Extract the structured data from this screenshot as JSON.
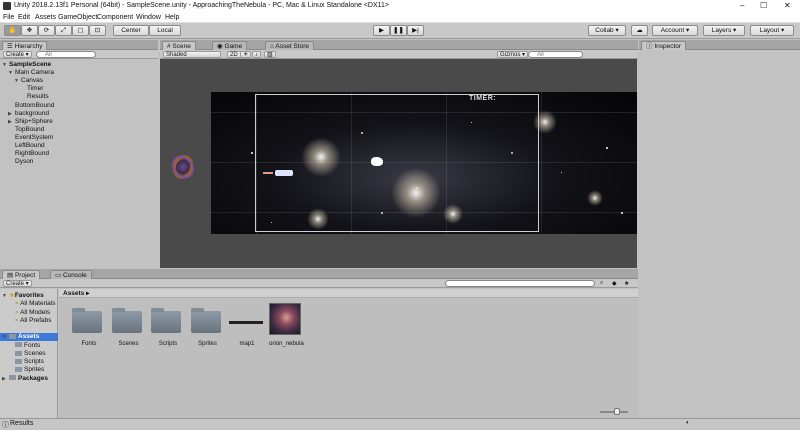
{
  "window": {
    "title": "Unity 2018.2.13f1 Personal (64bit) - SampleScene.unity - ApproachingTheNebula - PC, Mac & Linux Standalone <DX11>",
    "minimize": "–",
    "maximize": "☐",
    "close": "✕"
  },
  "menu": [
    "File",
    "Edit",
    "Assets",
    "GameObject",
    "Component",
    "Window",
    "Help"
  ],
  "toolbar": {
    "pivot": "Center",
    "space": "Local",
    "collab": "Collab ▾",
    "account": "Account ▾",
    "layers": "Layers ▾",
    "layout": "Layout ▾"
  },
  "hierarchy": {
    "tab": "Hierarchy",
    "create": "Create ▾",
    "search_placeholder": "All",
    "items": [
      {
        "label": "SampleScene",
        "indent": 0,
        "arrow": "▼",
        "bold": true
      },
      {
        "label": "Main Camera",
        "indent": 1,
        "arrow": "▼"
      },
      {
        "label": "Canvas",
        "indent": 2,
        "arrow": "▼"
      },
      {
        "label": "Timer",
        "indent": 3,
        "arrow": ""
      },
      {
        "label": "Results",
        "indent": 3,
        "arrow": ""
      },
      {
        "label": "BottomBound",
        "indent": 1,
        "arrow": ""
      },
      {
        "label": "background",
        "indent": 1,
        "arrow": "▶"
      },
      {
        "label": "Ship+Sphere",
        "indent": 1,
        "arrow": "▶"
      },
      {
        "label": "TopBound",
        "indent": 1,
        "arrow": ""
      },
      {
        "label": "EventSystem",
        "indent": 1,
        "arrow": ""
      },
      {
        "label": "LeftBound",
        "indent": 1,
        "arrow": ""
      },
      {
        "label": "RightBound",
        "indent": 1,
        "arrow": ""
      },
      {
        "label": "Dyson",
        "indent": 1,
        "arrow": ""
      }
    ]
  },
  "scene": {
    "tabs": {
      "scene": "Scene",
      "game": "Game",
      "store": "Asset Store"
    },
    "shading": "Shaded",
    "mode2d": "2D",
    "gizmos": "Gizmos ▾",
    "search_placeholder": "All",
    "timer_text": "TIMER:"
  },
  "inspector": {
    "tab": "Inspector"
  },
  "project": {
    "tabs": {
      "project": "Project",
      "console": "Console"
    },
    "create": "Create ▾",
    "breadcrumb": "Assets ▸",
    "tree": [
      {
        "label": "Favorites",
        "indent": 0,
        "arrow": "▼",
        "bold": true,
        "kind": "fav"
      },
      {
        "label": "All Materials",
        "indent": 1,
        "arrow": "",
        "kind": "search"
      },
      {
        "label": "All Models",
        "indent": 1,
        "arrow": "",
        "kind": "search"
      },
      {
        "label": "All Prefabs",
        "indent": 1,
        "arrow": "",
        "kind": "search"
      },
      {
        "label": "Assets",
        "indent": 0,
        "arrow": "▼",
        "bold": true,
        "kind": "folder",
        "selected": true
      },
      {
        "label": "Fonts",
        "indent": 1,
        "arrow": "",
        "kind": "folder"
      },
      {
        "label": "Scenes",
        "indent": 1,
        "arrow": "",
        "kind": "folder"
      },
      {
        "label": "Scripts",
        "indent": 1,
        "arrow": "",
        "kind": "folder"
      },
      {
        "label": "Sprites",
        "indent": 1,
        "arrow": "",
        "kind": "folder"
      },
      {
        "label": "Packages",
        "indent": 0,
        "arrow": "▶",
        "bold": true,
        "kind": "folder"
      }
    ],
    "assets": [
      {
        "label": "Fonts",
        "kind": "folder"
      },
      {
        "label": "Scenes",
        "kind": "folder"
      },
      {
        "label": "Scripts",
        "kind": "folder"
      },
      {
        "label": "Sprites",
        "kind": "folder"
      },
      {
        "label": "map1",
        "kind": "prefab"
      },
      {
        "label": "orion_nebula",
        "kind": "texture"
      }
    ]
  },
  "status": {
    "text": "Results"
  }
}
